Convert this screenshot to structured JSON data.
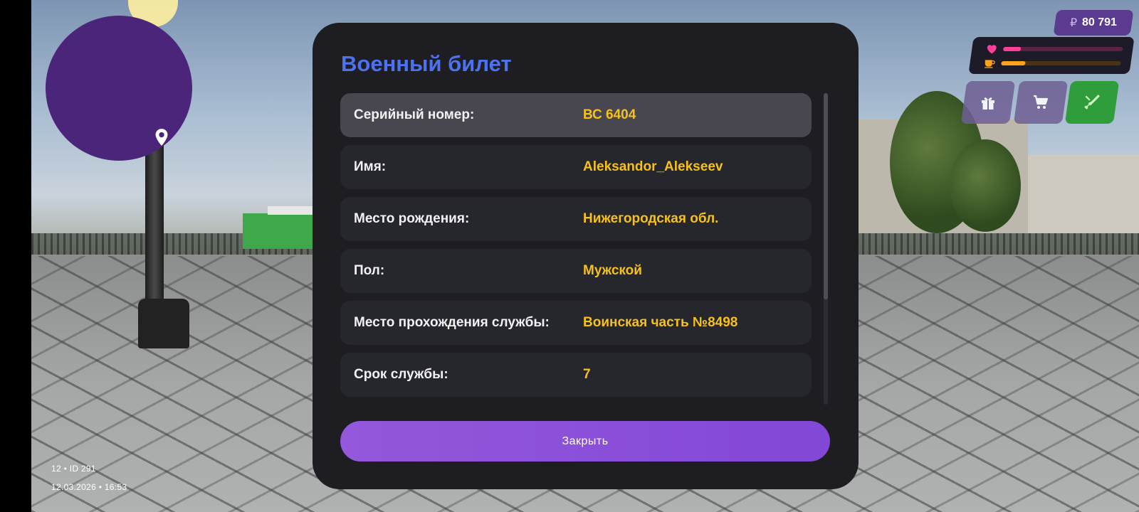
{
  "hud": {
    "money_icon": "ruble-icon",
    "money_symbol": "₽",
    "money": "80 791",
    "health_level": 0.15,
    "hunger_level": 0.2,
    "colors": {
      "health": "#ff3f9a",
      "hunger": "#ffa21a",
      "panel": "#5b3b8f",
      "active_button": "#2f9d3c"
    },
    "buttons": [
      {
        "icon": "gift-icon"
      },
      {
        "icon": "cart-icon"
      },
      {
        "icon": "weapon-icon"
      }
    ]
  },
  "minimap": {
    "icon": "location-pin-icon"
  },
  "status": {
    "line1": "12 • ID 291",
    "line2": "12.03.2026 • 16:53"
  },
  "modal": {
    "title": "Военный билет",
    "rows": [
      {
        "label": "Серийный номер:",
        "value": "ВС 6404"
      },
      {
        "label": "Имя:",
        "value": "Aleksandor_Alekseev"
      },
      {
        "label": "Место рождения:",
        "value": "Нижегородская обл."
      },
      {
        "label": "Пол:",
        "value": "Мужской"
      },
      {
        "label": "Место прохождения службы:",
        "value": "Воинская часть №8498"
      },
      {
        "label": "Срок службы:",
        "value": "7"
      }
    ],
    "close_label": "Закрыть",
    "colors": {
      "title": "#4d72ef",
      "value": "#f5c11a",
      "button": "#8a4fd8"
    }
  }
}
